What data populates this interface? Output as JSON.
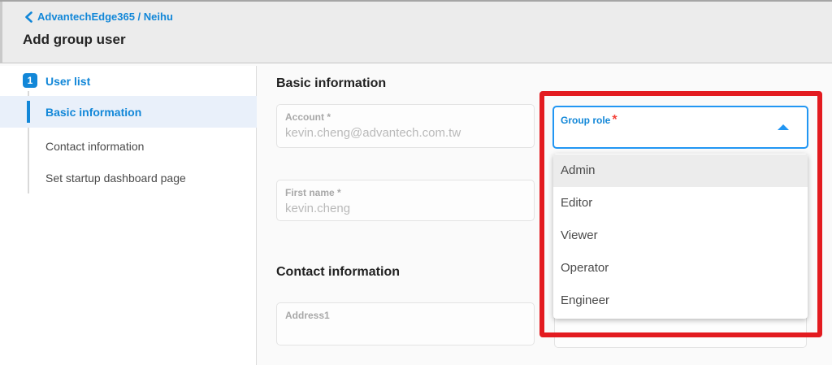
{
  "header": {
    "breadcrumb": "AdvantechEdge365 / Neihu",
    "title": "Add group user"
  },
  "sidebar": {
    "step_badge": "1",
    "items": [
      {
        "label": "User list"
      },
      {
        "label": "Basic information"
      },
      {
        "label": "Contact information"
      },
      {
        "label": "Set startup dashboard page"
      }
    ]
  },
  "form": {
    "section1_heading": "Basic information",
    "section2_heading": "Contact information",
    "account_label": "Account *",
    "account_value": "kevin.cheng@advantech.com.tw",
    "first_name_label": "First name *",
    "first_name_value": "kevin.cheng",
    "address1_label": "Address1"
  },
  "group_role": {
    "label": "Group role",
    "required_mark": "*",
    "options": [
      "Admin",
      "Editor",
      "Viewer",
      "Operator",
      "Engineer"
    ],
    "highlighted_option": "Admin"
  },
  "colors": {
    "accent_blue": "#1287d8",
    "select_border_blue": "#2196f3",
    "annotation_red": "#e31b20",
    "active_item_bg": "#e9f0fa",
    "header_bg": "#ececec"
  }
}
